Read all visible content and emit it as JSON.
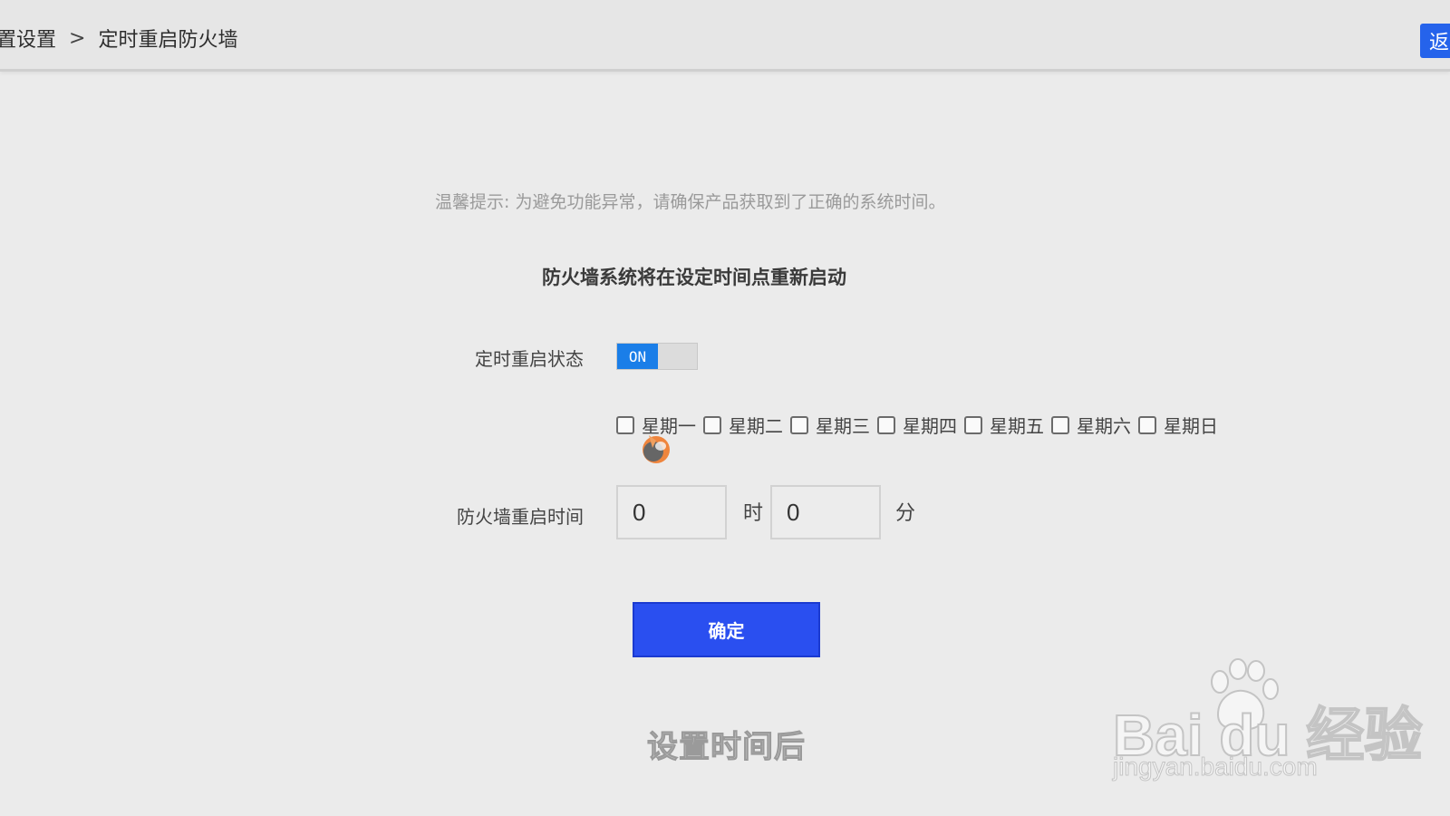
{
  "header": {
    "breadcrumb_parent": "置设置",
    "breadcrumb_separator": ">",
    "breadcrumb_current": "定时重启防火墙",
    "back_button_label": "返"
  },
  "main": {
    "tip": "温馨提示: 为避免功能异常，请确保产品获取到了正确的系统时间。",
    "heading": "防火墙系统将在设定时间点重新启动",
    "status_label": "定时重启状态",
    "toggle": {
      "state_label": "ON",
      "on": true
    },
    "days": [
      {
        "label": "星期一",
        "checked": false
      },
      {
        "label": "星期二",
        "checked": false
      },
      {
        "label": "星期三",
        "checked": false
      },
      {
        "label": "星期四",
        "checked": false
      },
      {
        "label": "星期五",
        "checked": false
      },
      {
        "label": "星期六",
        "checked": false
      },
      {
        "label": "星期日",
        "checked": false
      }
    ],
    "time_label": "防火墙重启时间",
    "hour_value": "0",
    "hour_unit": "时",
    "minute_value": "0",
    "minute_unit": "分",
    "confirm_label": "确定"
  },
  "overlay": {
    "subtitle": "设置时间后",
    "watermark_main": "Bai  du 经验",
    "watermark_sub": "jingyan.baidu.com"
  },
  "colors": {
    "accent_blue": "#2a4ff0",
    "toggle_blue": "#1a7ee8",
    "background": "#ebebeb"
  }
}
